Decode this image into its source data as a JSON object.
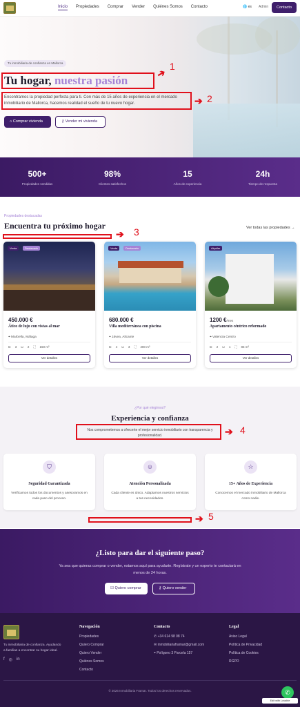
{
  "nav": {
    "links": [
      "Inicio",
      "Propiedades",
      "Comprar",
      "Vender",
      "Quiénes Somos",
      "Contacto"
    ],
    "lang": "es",
    "admin": "Admin",
    "contact_btn": "Contacto",
    "lang2": "es"
  },
  "hero": {
    "badge": "Tu inmobiliaria de confianza en Mallorca",
    "title_main": "Tu hogar,",
    "title_accent": "nuestra pasión",
    "description": "Encontramos la propiedad perfecta para ti. Con más de 15 años de experiencia en el mercado inmobiliario de Mallorca, hacemos realidad el sueño de tu nuevo hogar.",
    "btn_buy": "Comprar vivienda",
    "btn_sell": "Vender mi vivienda"
  },
  "annotations": [
    "1",
    "2",
    "3",
    "4",
    "5"
  ],
  "stats": [
    {
      "value": "500+",
      "label": "Propiedades vendidas"
    },
    {
      "value": "98%",
      "label": "Clientes satisfechos"
    },
    {
      "value": "15",
      "label": "Años de experiencia"
    },
    {
      "value": "24h",
      "label": "Tiempo de respuesta"
    }
  ],
  "featured": {
    "label": "Propiedades destacadas",
    "title": "Encuentra tu próximo hogar",
    "see_all": "Ver todas las propiedades",
    "cards": [
      {
        "tags": [
          "Venta",
          "Destacado"
        ],
        "price": "450.000 €",
        "price_suffix": "",
        "title": "Ático de lujo con vistas al mar",
        "location": "Marbella, Málaga",
        "beds": "3",
        "baths": "2",
        "area": "150 m²",
        "btn": "Ver detalles"
      },
      {
        "tags": [
          "Venta",
          "Destacado"
        ],
        "price": "680.000 €",
        "price_suffix": "",
        "title": "Villa mediterránea con piscina",
        "location": "Jávea, Alicante",
        "beds": "4",
        "baths": "3",
        "area": "280 m²",
        "btn": "Ver detalles"
      },
      {
        "tags": [
          "Alquiler"
        ],
        "price": "1200 €",
        "price_suffix": "/mes",
        "title": "Apartamento céntrico reformado",
        "location": "Valencia Centro",
        "beds": "2",
        "baths": "1",
        "area": "85 m²",
        "btn": "Ver detalles"
      }
    ]
  },
  "why": {
    "label": "¿Por qué elegirnos?",
    "title": "Experiencia y confianza",
    "description": "Nos comprometemos a ofrecerte el mejor servicio inmobiliario con transparencia y profesionalidad.",
    "features": [
      {
        "icon": "shield-icon",
        "title": "Seguridad Garantizada",
        "desc": "Verificamos todos los documentos y asesoramos en cada paso del proceso."
      },
      {
        "icon": "users-icon",
        "title": "Atención Personalizada",
        "desc": "Cada cliente es único. Adaptamos nuestros servicios a tus necesidades."
      },
      {
        "icon": "star-icon",
        "title": "15+ Años de Experiencia",
        "desc": "Conocemos el mercado inmobiliario de Mallorca como nadie."
      }
    ]
  },
  "cta": {
    "title": "¿Listo para dar el siguiente paso?",
    "description": "Ya sea que quieras comprar o vender, estamos aquí para ayudarte. Regístrate y un experto te contactará en menos de 24 horas.",
    "btn_buy": "Quiero comprar",
    "btn_sell": "Quiero vender"
  },
  "footer": {
    "description": "Tu inmobiliaria de confianza. Ayudando a familias a encontrar su hogar ideal.",
    "nav_title": "Navegación",
    "nav_items": [
      "Propiedades",
      "Quiero Comprar",
      "Quiero Vender",
      "Quiénes Somos",
      "Contacto"
    ],
    "contact_title": "Contacto",
    "phone": "+34 614 98 08 74",
    "email": "inmobiliariaframar@gmail.com",
    "address": "Polígono 3 Parcela 157",
    "legal_title": "Legal",
    "legal_items": [
      "Aviso Legal",
      "Política de Privacidad",
      "Política de Cookies",
      "RGPD"
    ],
    "copyright": "© 2026 Inmobiliaria Framar. Todos los derechos reservados.",
    "lovable": "Edit with Lovable"
  },
  "colors": {
    "primary": "#3f1f6b",
    "accent": "#a583d6",
    "annotation": "#e0101b"
  }
}
